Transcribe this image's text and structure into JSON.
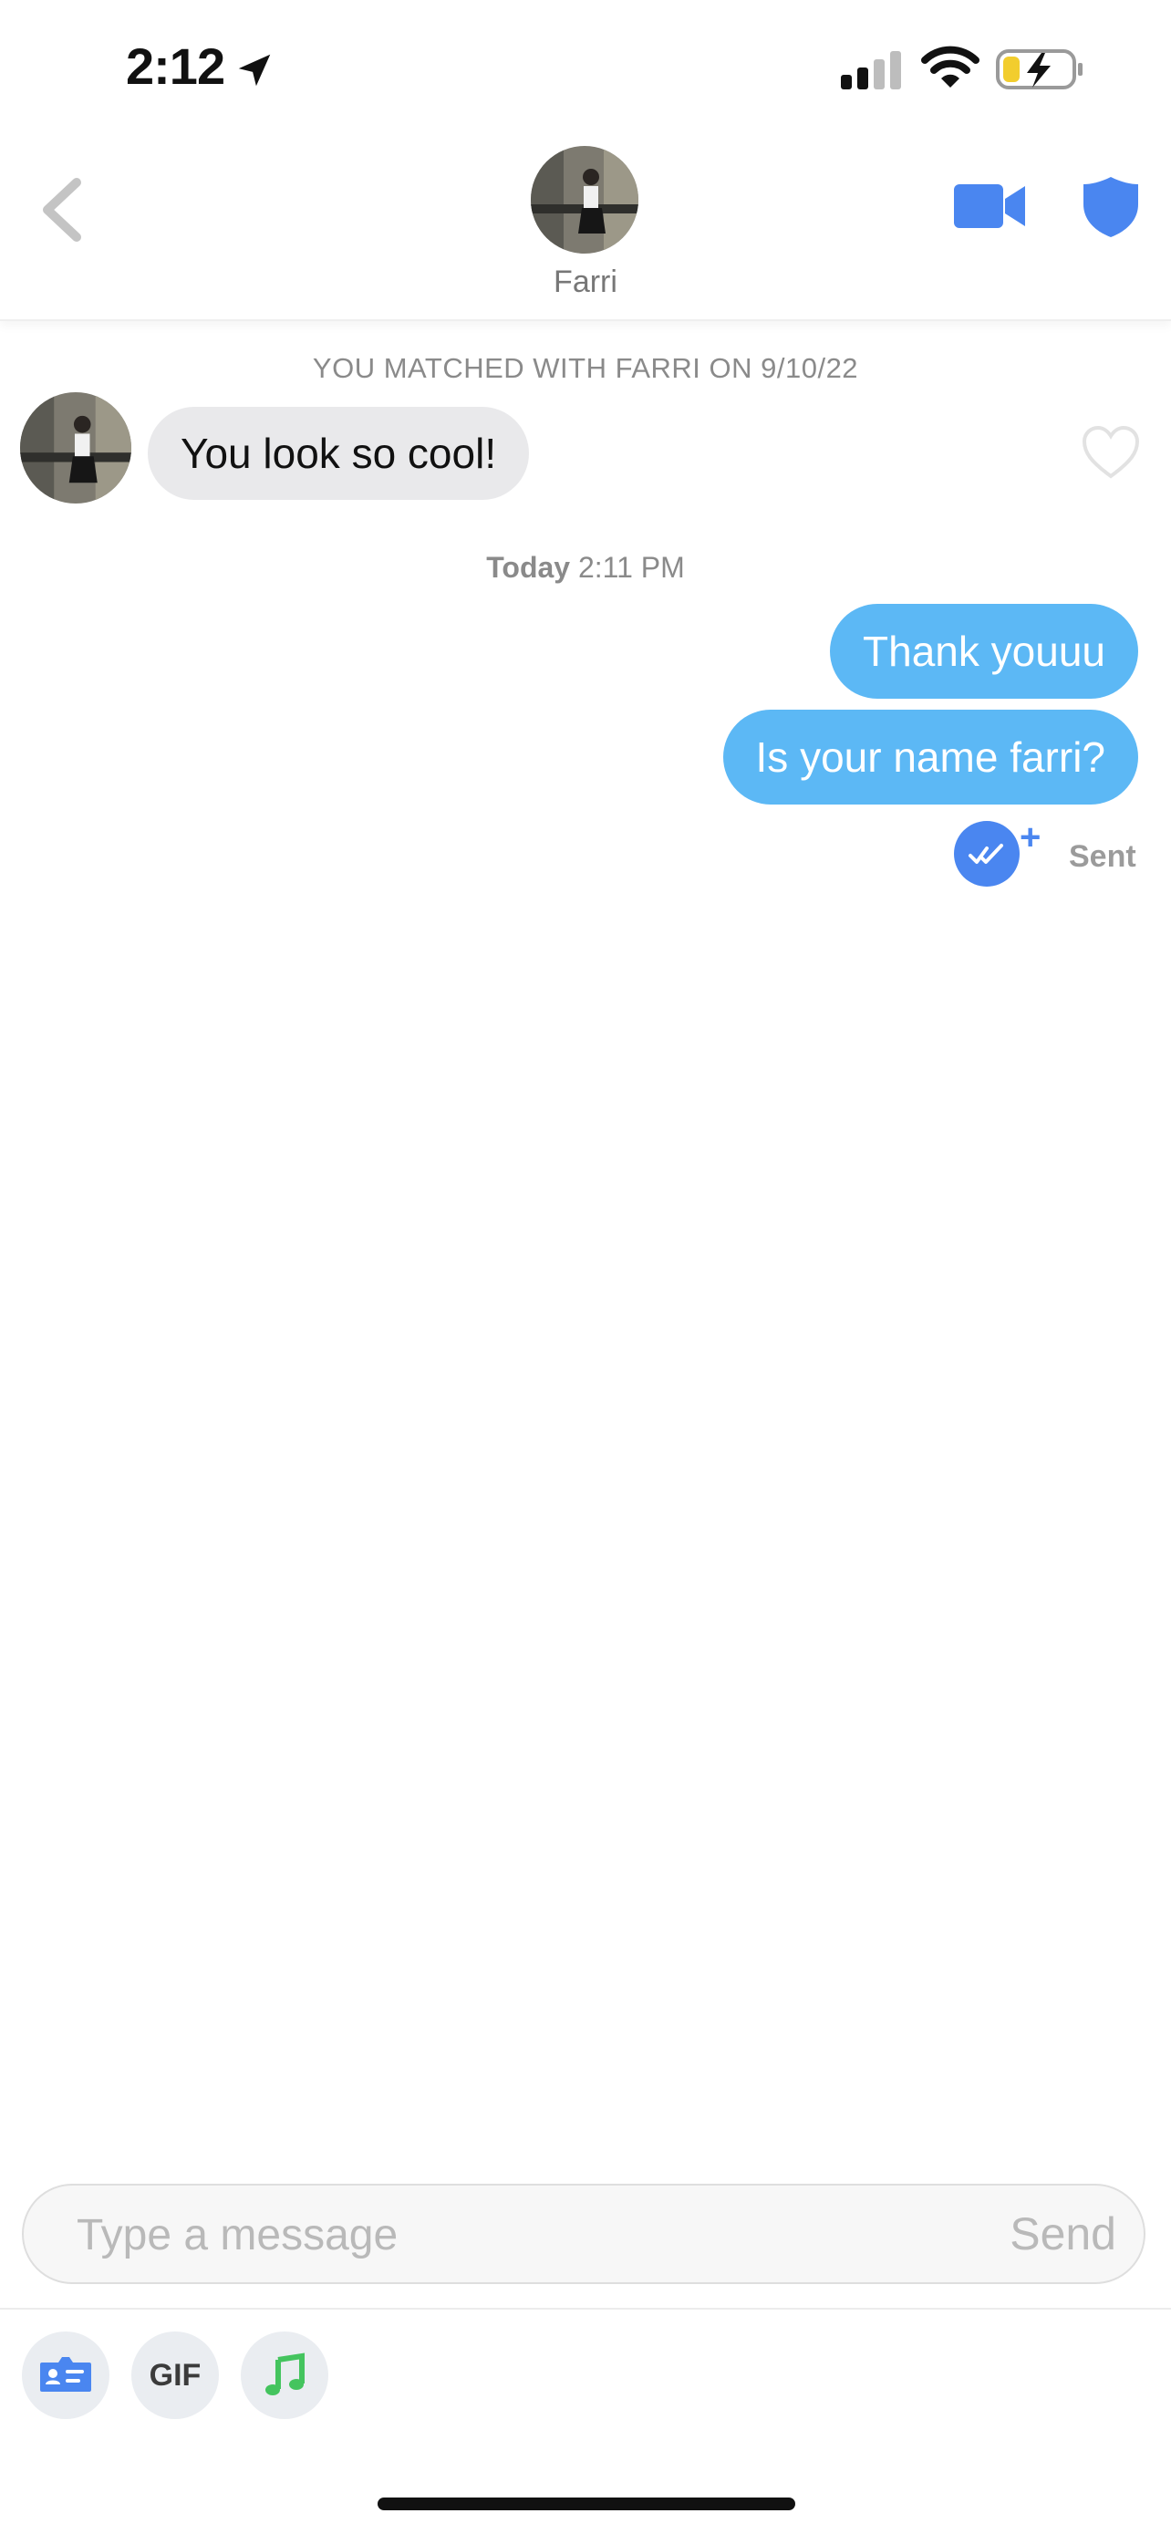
{
  "status_bar": {
    "time": "2:12"
  },
  "header": {
    "contact_name": "Farri"
  },
  "conversation": {
    "match_banner": "YOU MATCHED WITH FARRI ON 9/10/22",
    "incoming": [
      {
        "text": "You look so cool!"
      }
    ],
    "timestamp": {
      "day": "Today",
      "time": "2:11 PM"
    },
    "outgoing": [
      {
        "text": "Thank youuu"
      },
      {
        "text": "Is your name farri?"
      }
    ],
    "status": "Sent"
  },
  "composer": {
    "placeholder": "Type a message",
    "send_label": "Send"
  },
  "toolbar": {
    "gif_label": "GIF"
  },
  "colors": {
    "accent": "#4a86f0",
    "outgoing_bubble": "#5cb8f5",
    "incoming_bubble": "#e9e9eb"
  }
}
